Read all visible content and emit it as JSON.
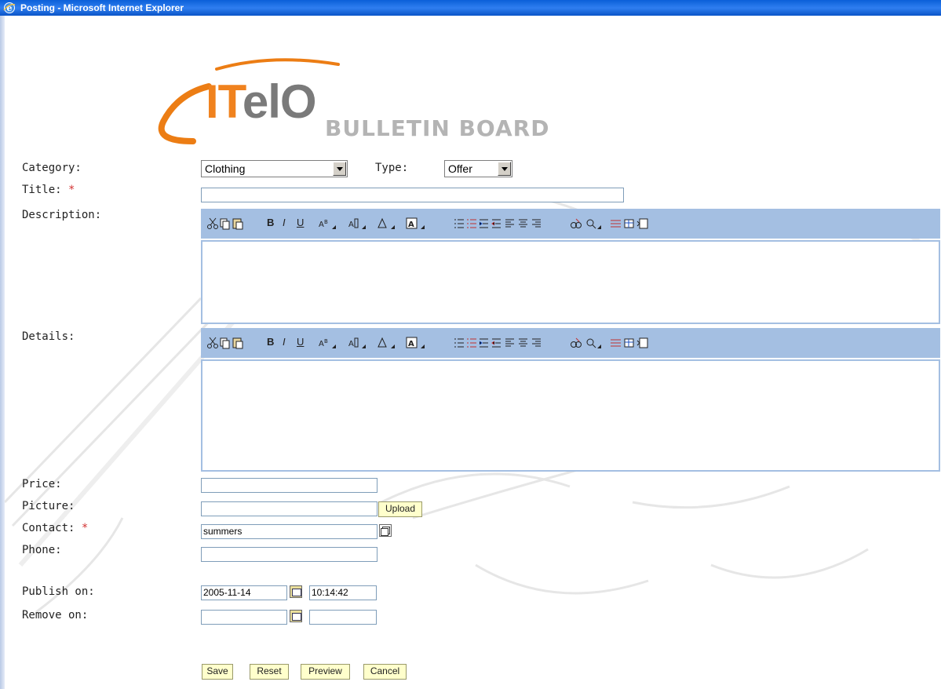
{
  "window": {
    "title": "Posting - Microsoft Internet Explorer"
  },
  "logo": {
    "word_i": "IT",
    "word_rest": "elO",
    "subtitle": "BULLETIN BOARD"
  },
  "form": {
    "category": {
      "label": "Category:",
      "value": "Clothing"
    },
    "type": {
      "label": "Type:",
      "value": "Offer"
    },
    "title": {
      "label": "Title:",
      "required": "*",
      "value": ""
    },
    "description": {
      "label": "Description:"
    },
    "details": {
      "label": "Details:"
    },
    "price": {
      "label": "Price:",
      "value": ""
    },
    "picture": {
      "label": "Picture:",
      "value": "",
      "upload_label": "Upload"
    },
    "contact": {
      "label": "Contact:",
      "required": "*",
      "value": "summers"
    },
    "phone": {
      "label": "Phone:",
      "value": ""
    },
    "publish_on": {
      "label": "Publish on:",
      "date": "2005-11-14",
      "time": "10:14:42"
    },
    "remove_on": {
      "label": "Remove on:",
      "date": "",
      "time": ""
    }
  },
  "toolbar": {
    "bold": "B",
    "italic": "I",
    "underline": "U",
    "icons": [
      "cut-icon",
      "copy-icon",
      "paste-icon",
      "bold-icon",
      "italic-icon",
      "underline-icon",
      "font-size-icon",
      "font-style-icon",
      "text-color-icon",
      "highlight-color-icon",
      "bullet-list-icon",
      "numbered-list-icon",
      "indent-icon",
      "outdent-icon",
      "align-left-icon",
      "align-center-icon",
      "align-right-icon",
      "link-icon",
      "image-icon",
      "horizontal-rule-icon",
      "table-icon",
      "html-icon"
    ]
  },
  "buttons": {
    "save": "Save",
    "reset": "Reset",
    "preview": "Preview",
    "cancel": "Cancel"
  },
  "colors": {
    "titlebar": "#0a5fd8",
    "toolbar": "#a4bfe2",
    "accent": "#f0821e",
    "button": "#ffffcc",
    "required": "#d23030"
  }
}
